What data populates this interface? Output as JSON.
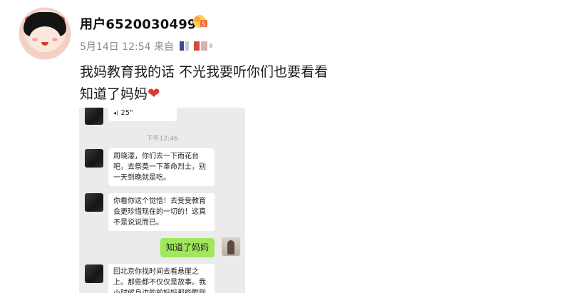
{
  "post": {
    "username": "用户6520030499",
    "date": "5月14日 12:54",
    "source_prefix": "来自",
    "text_line1": "我妈教育我的话 不光我要听你们也要看看",
    "text_line2": "知道了妈妈",
    "heart": "❤"
  },
  "screenshot": {
    "voice_duration": "25\"",
    "voice_icon": "◂)",
    "timestamp": "下午12:46",
    "msg1": "周晓濛，你们去一下雨花台吧，去祭奠一下革命烈士，别一天到晚就是吃。",
    "msg2": "你看你这个觉悟！去受受教育会更珍惜现在的一切的！这真不是说说而已。",
    "reply": "知道了妈妈",
    "msg3": "回北京你找时间去看悬崖之上。那些都不仅仅是故事。我小时候身边的前妈妈那些酷刑"
  },
  "icons": {
    "avatar": "avatar",
    "badge": "fan-badge-icon",
    "heart": "heart-icon"
  },
  "colors": {
    "reply_bubble": "#a0e75a",
    "chat_bg": "#ebebeb",
    "heart": "#e23636"
  }
}
